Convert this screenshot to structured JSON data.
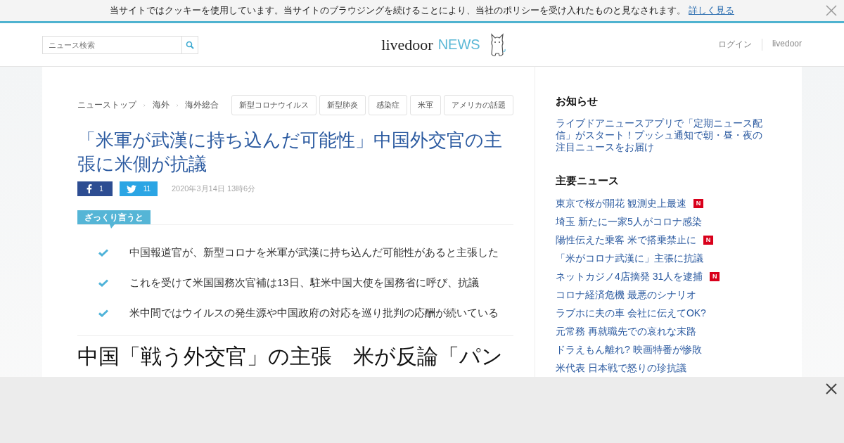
{
  "cookie_bar": {
    "message": "当サイトではクッキーを使用しています。当サイトのブラウジングを続けることにより、当社のポリシーを受け入れたものと見なされます。",
    "link": "詳しく見る"
  },
  "header": {
    "search": {
      "placeholder": "ニュース検索"
    },
    "logo": {
      "brand": "livedoor",
      "suffix": "NEWS"
    },
    "nav": [
      "ログイン",
      "livedoor"
    ]
  },
  "breadcrumbs": [
    "ニューストップ",
    "海外",
    "海外総合"
  ],
  "tags": [
    "新型コロナウイルス",
    "新型肺炎",
    "感染症",
    "米軍",
    "アメリカの話題"
  ],
  "article": {
    "title": "「米軍が武漢に持ち込んだ可能性」中国外交官の主張に米側が抗議",
    "share": [
      {
        "kind": "facebook",
        "count": "1"
      },
      {
        "kind": "twitter",
        "count": "11"
      }
    ],
    "date": "2020年3月14日 13時6分",
    "summary": {
      "label": "ざっくり言うと",
      "points": [
        "中国報道官が、新型コロナを米軍が武漢に持ち込んだ可能性があると主張した",
        "これを受けて米国国務次官補は13日、駐米中国大使を国務省に呼び、抗議",
        "米中間ではウイルスの発生源や中国政府の対応を巡り批判の応酬が続いている"
      ]
    },
    "related_title": "中国「戦う外交官」の主張　米が反論「パン"
  },
  "sidebar": {
    "notice": {
      "heading": "お知らせ",
      "text": "ライブドアニュースアプリで「定期ニュース配信」がスタート！プッシュ通知で朝・昼・夜の注目ニュースをお届け"
    },
    "top_news": {
      "heading": "主要ニュース",
      "items": [
        {
          "title": "東京で桜が開花 観測史上最速",
          "badge": "N"
        },
        {
          "title": "埼玉 新たに一家5人がコロナ感染"
        },
        {
          "title": "陽性伝えた乗客 米で搭乗禁止に",
          "badge": "N"
        },
        {
          "title": "「米がコロナ武漢に」主張に抗議"
        },
        {
          "title": "ネットカジノ4店摘発 31人を逮捕",
          "badge": "N"
        },
        {
          "title": "コロナ経済危機 最悪のシナリオ"
        },
        {
          "title": "ラブホに夫の車 会社に伝えてOK?"
        },
        {
          "title": "元常務 再就職先での哀れな末路"
        },
        {
          "title": "ドラえもん離れ? 映画特番が惨敗"
        },
        {
          "title": "米代表 日本戦で怒りの珍抗議"
        }
      ]
    }
  }
}
